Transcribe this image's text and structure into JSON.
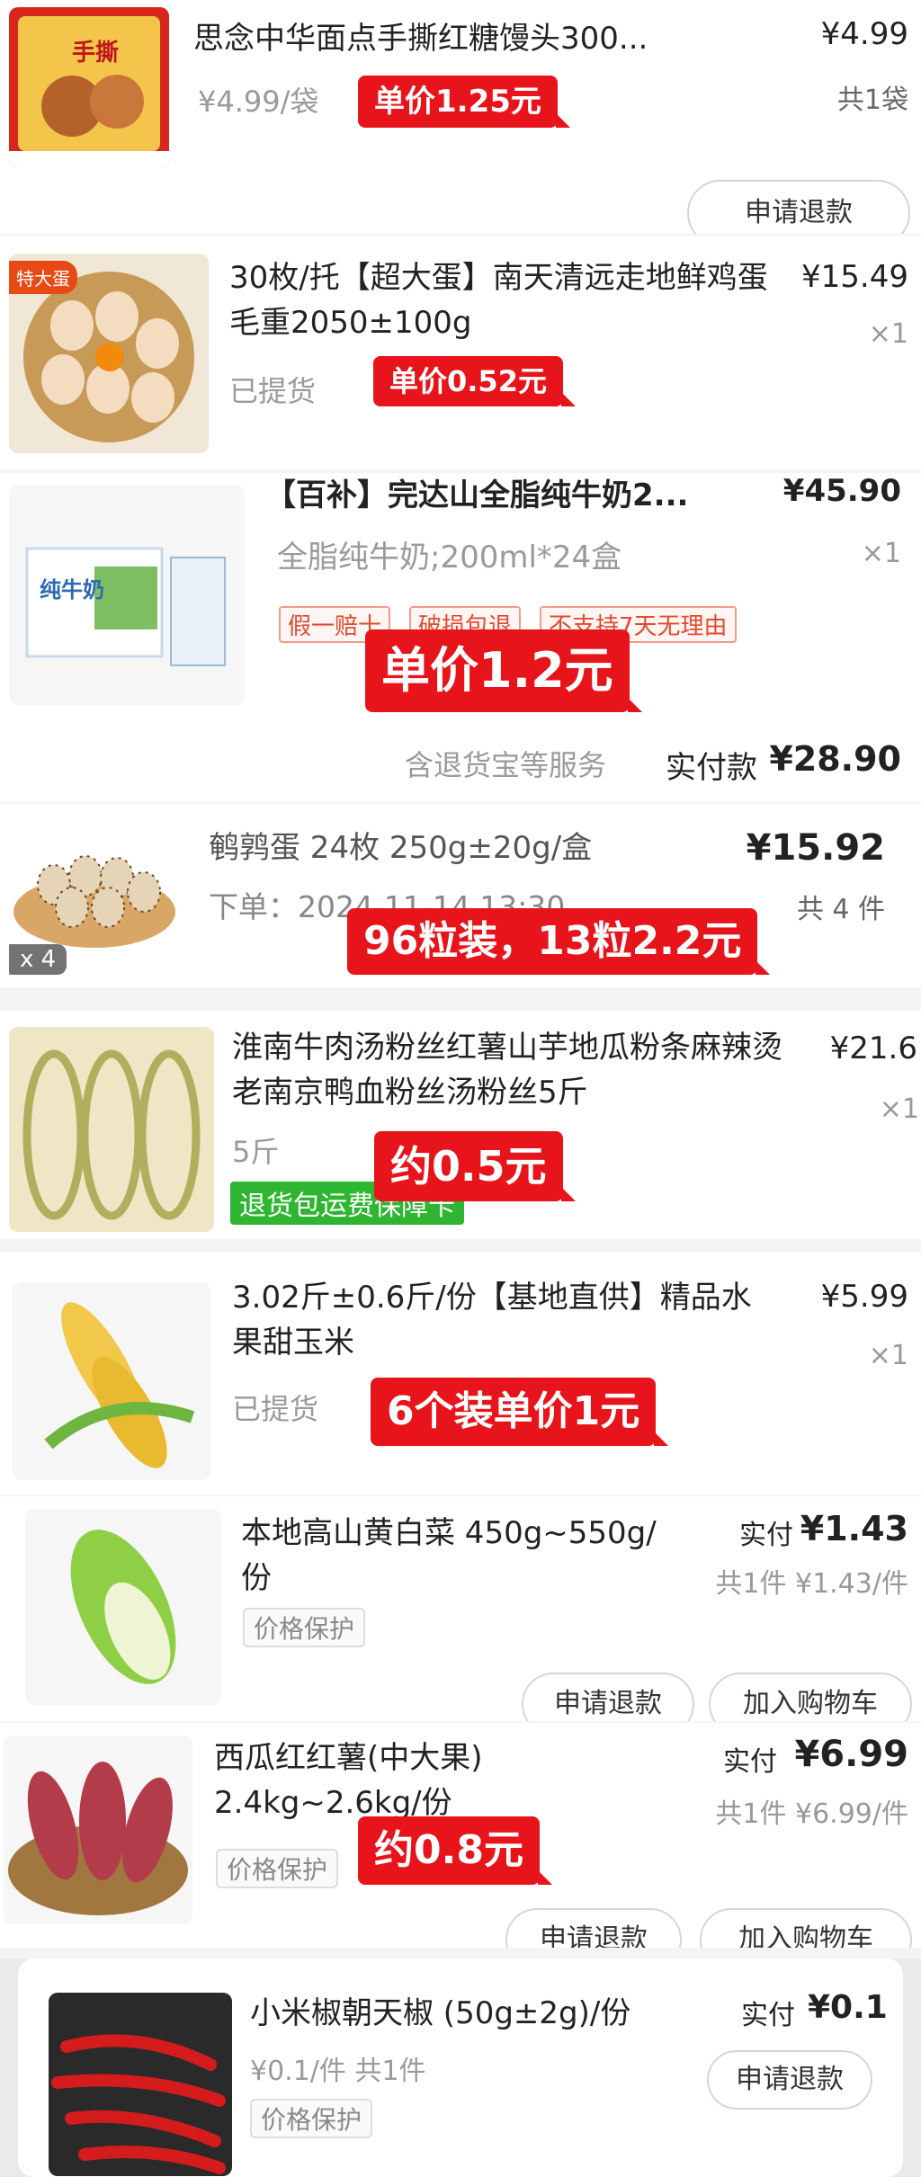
{
  "items": [
    {
      "title": "思念中华面点手撕红糖馒头300...",
      "price": "¥4.99",
      "sub": "¥4.99/袋",
      "qty": "共1袋",
      "badge": "单价1.25元",
      "refund": "申请退款",
      "img_icon": "steamed-bun-package",
      "img_label": "手撕"
    },
    {
      "title": "30枚/托【超大蛋】南天清远走地鲜鸡蛋毛重2050±100g",
      "price": "¥15.49",
      "qty": "×1",
      "status": "已提货",
      "badge": "单价0.52元",
      "img_icon": "eggs-basket",
      "img_tag": "特大蛋"
    },
    {
      "title": "【百补】完达山全脂纯牛奶2...",
      "price": "¥45.90",
      "sub": "全脂纯牛奶;200ml*24盒",
      "qty": "×1",
      "tags": [
        "假一赔十",
        "破损包退",
        "不支持7天无理由"
      ],
      "badge": "单价1.2元",
      "service": "含退货宝等服务",
      "paid_label": "实付款",
      "paid": "¥28.90",
      "img_icon": "milk-carton",
      "img_label": "纯牛奶"
    },
    {
      "title": "鹌鹑蛋 24枚 250g±20g/盒",
      "price": "¥15.92",
      "order": "下单：2024-11-14 13:30",
      "qty": "共 4 件",
      "count": "x 4",
      "badge": "96粒装，13粒2.2元",
      "img_icon": "quail-eggs"
    },
    {
      "title": "淮南牛肉汤粉丝红薯山芋地瓜粉条麻辣烫老南京鸭血粉丝汤粉丝5斤",
      "price": "¥21.6",
      "qty": "×1",
      "sub": "5斤",
      "green": "退货包运费保障卡",
      "badge": "约0.5元",
      "img_icon": "vermicelli"
    },
    {
      "title": "3.02斤±0.6斤/份【基地直供】精品水果甜玉米",
      "price": "¥5.99",
      "qty": "×1",
      "status": "已提货",
      "badge": "6个装单价1元",
      "img_icon": "corn"
    },
    {
      "title": "本地高山黄白菜 450g~550g/份",
      "paid_label": "实付",
      "paid": "¥1.43",
      "unit": "共1件 ¥1.43/件",
      "tag": "价格保护",
      "refund": "申请退款",
      "cart": "加入购物车",
      "img_icon": "cabbage"
    },
    {
      "title": "西瓜红红薯(中大果) 2.4kg~2.6kg/份",
      "paid_label": "实付",
      "paid": "¥6.99",
      "unit": "共1件 ¥6.99/件",
      "tag": "价格保护",
      "badge": "约0.8元",
      "refund": "申请退款",
      "cart": "加入购物车",
      "img_icon": "sweet-potato"
    },
    {
      "title": "小米椒朝天椒 (50g±2g)/份",
      "unit": "¥0.1/件  共1件",
      "paid_label": "实付",
      "paid": "¥0.1",
      "tag": "价格保护",
      "refund": "申请退款",
      "img_icon": "chili-peppers"
    }
  ]
}
